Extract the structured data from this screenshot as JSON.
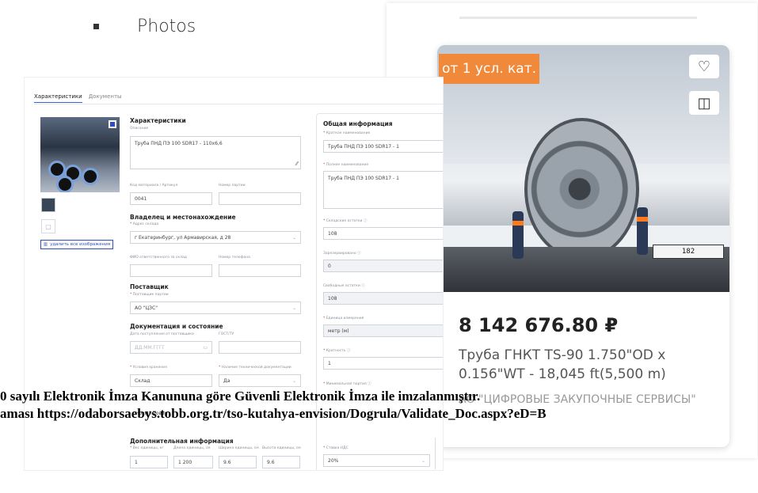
{
  "bullet": {
    "text": "Photos"
  },
  "form": {
    "tabs": [
      {
        "label": "Характеристики"
      },
      {
        "label": "Документы"
      }
    ],
    "delete_images_label": "удалить все изображения",
    "characteristics": {
      "title": "Характеристики",
      "desc_label": "Описание",
      "desc_value": "Труба ПНД ПЭ 100 SDR17 - 110х6,6",
      "code_label": "Код материала / Артикул",
      "code_value": "0041",
      "batch_label": "Номер партии"
    },
    "owner": {
      "title": "Владелец и местонахождение",
      "address_label": "Адрес склада",
      "address_value": "г Екатеринбург, ул Армавирская, д 28",
      "responsible_label": "ФИО ответственного за склад",
      "phone_label": "Номер телефона"
    },
    "supplier": {
      "title": "Поставщик",
      "label": "Поставщик партии",
      "value": "АО \"ЦЗС\""
    },
    "docs": {
      "title": "Документация и состояние",
      "date_label": "Дата поступления от поставщика",
      "date_placeholder": "ДД.ММ.ГГГГ",
      "tu_label": "ГОСТ/ТУ",
      "storage_label": "Условия хранения",
      "storage_value": "Склад",
      "techdoc_label": "Наличие технической документации",
      "techdoc_value": "Да",
      "state_value": "Новый Товар"
    },
    "extra": {
      "title": "Дополнительная информация",
      "weight_label": "Вес единицы, кг",
      "weight_value": "1",
      "length_label": "Длина единицы, см",
      "length_value": "1 200",
      "width_label": "Ширина единицы, см",
      "width_value": "9.6",
      "height_label": "Высота единицы, см",
      "height_value": "9.6"
    },
    "general": {
      "title": "Общая информация",
      "short_label": "Краткое наименование",
      "short_value": "Труба ПНД ПЭ 100 SDR17 - 1",
      "full_label": "Полное наименование",
      "full_value": "Труба ПНД ПЭ 100 SDR17 - 1",
      "stock_label": "Складские остатки",
      "stock_value": "108",
      "reserved_label": "Зарезервировано",
      "reserved_value": "0",
      "free_label": "Свободные остатки",
      "free_value": "108",
      "unit_label": "Единица измерения",
      "unit_value": "метр (м)",
      "mult_label": "Кратность",
      "mult_value": "1",
      "min_label": "Минимальная партия",
      "vat_label": "Ставка НДС",
      "vat_value": "20%"
    }
  },
  "card": {
    "badge": "от 1 усл. кат.",
    "plate": "182",
    "price": "8 142 676.80 ₽",
    "description": "Труба ГНКТ TS-90 1.750\"OD x 0.156\"WT - 18,045 ft(5,500 m)",
    "seller": "АО \"ЦИФРОВЫЕ ЗАКУПОЧНЫЕ СЕРВИСЫ\""
  },
  "overlay": {
    "line1": "0 sayılı Elektronik İmza Kanununa göre Güvenli Elektronik İmza ile imzalanmıştır.",
    "line2": "aması https://odaborsaebys.tobb.org.tr/tso-kutahya-envision/Dogrula/Validate_Doc.aspx?eD=B"
  }
}
